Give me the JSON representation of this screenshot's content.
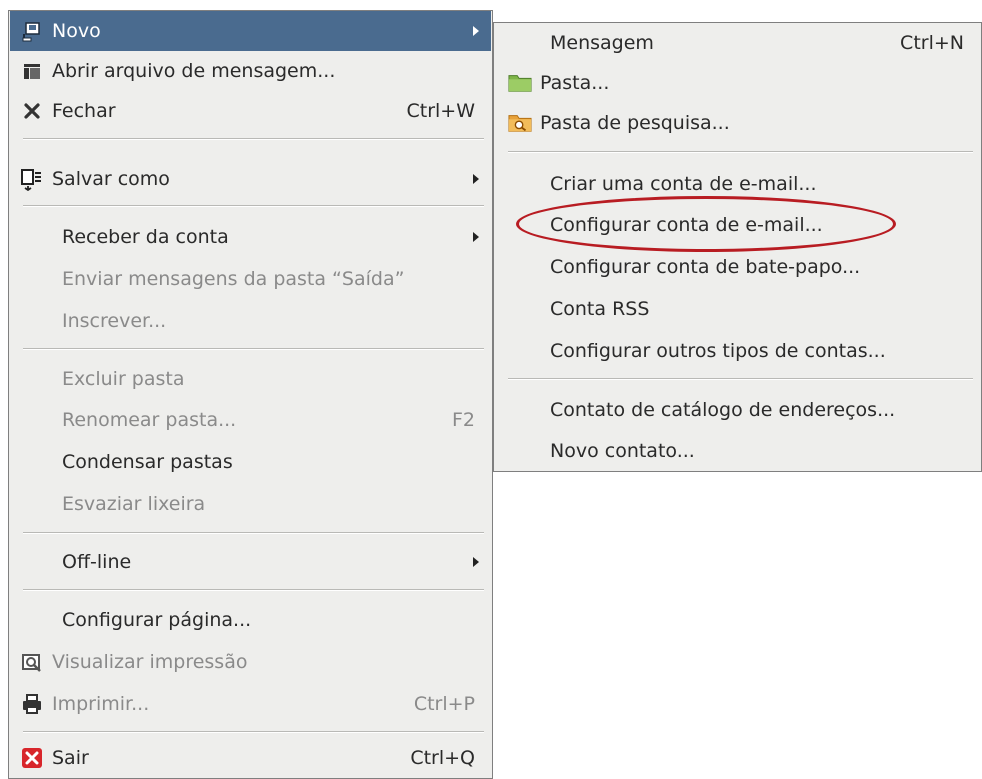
{
  "main_menu": {
    "new": {
      "label": "Novo"
    },
    "open_message_file": {
      "label": "Abrir arquivo de mensagem..."
    },
    "close": {
      "label": "Fechar",
      "shortcut": "Ctrl+W"
    },
    "save_as": {
      "label": "Salvar como"
    },
    "get_from_account": {
      "label": "Receber da conta"
    },
    "send_outbox": {
      "label": "Enviar mensagens da pasta “Saída”"
    },
    "subscribe": {
      "label": "Inscrever..."
    },
    "delete_folder": {
      "label": "Excluir pasta"
    },
    "rename_folder": {
      "label": "Renomear pasta...",
      "shortcut": "F2"
    },
    "compact_folders": {
      "label": "Condensar pastas"
    },
    "empty_trash": {
      "label": "Esvaziar lixeira"
    },
    "offline": {
      "label": "Off-line"
    },
    "page_setup": {
      "label": "Configurar página..."
    },
    "print_preview": {
      "label": "Visualizar impressão"
    },
    "print": {
      "label": "Imprimir...",
      "shortcut": "Ctrl+P"
    },
    "quit": {
      "label": "Sair",
      "shortcut": "Ctrl+Q"
    }
  },
  "submenu": {
    "message": {
      "label": "Mensagem",
      "shortcut": "Ctrl+N"
    },
    "folder": {
      "label": "Pasta..."
    },
    "search_folder": {
      "label": "Pasta de pesquisa..."
    },
    "create_email_account": {
      "label": "Criar uma conta de e-mail..."
    },
    "configure_email_account": {
      "label": "Configurar conta de e-mail..."
    },
    "configure_chat_account": {
      "label": "Configurar conta de bate-papo..."
    },
    "rss_account": {
      "label": "Conta RSS"
    },
    "other_accounts": {
      "label": "Configurar outros tipos de contas..."
    },
    "address_book_contact": {
      "label": "Contato de catálogo de endereços..."
    },
    "new_contact": {
      "label": "Novo contato..."
    }
  },
  "colors": {
    "menu_bg": "#eeeeec",
    "highlight": "#4a6b8f",
    "annotation": "#b81c22"
  },
  "icons": {
    "new": "new-message-icon",
    "open": "open-file-icon",
    "close": "close-x-icon",
    "save": "save-as-icon",
    "preview": "print-preview-icon",
    "print": "printer-icon",
    "quit": "quit-icon",
    "folder": "folder-icon",
    "search_folder": "search-folder-icon"
  }
}
